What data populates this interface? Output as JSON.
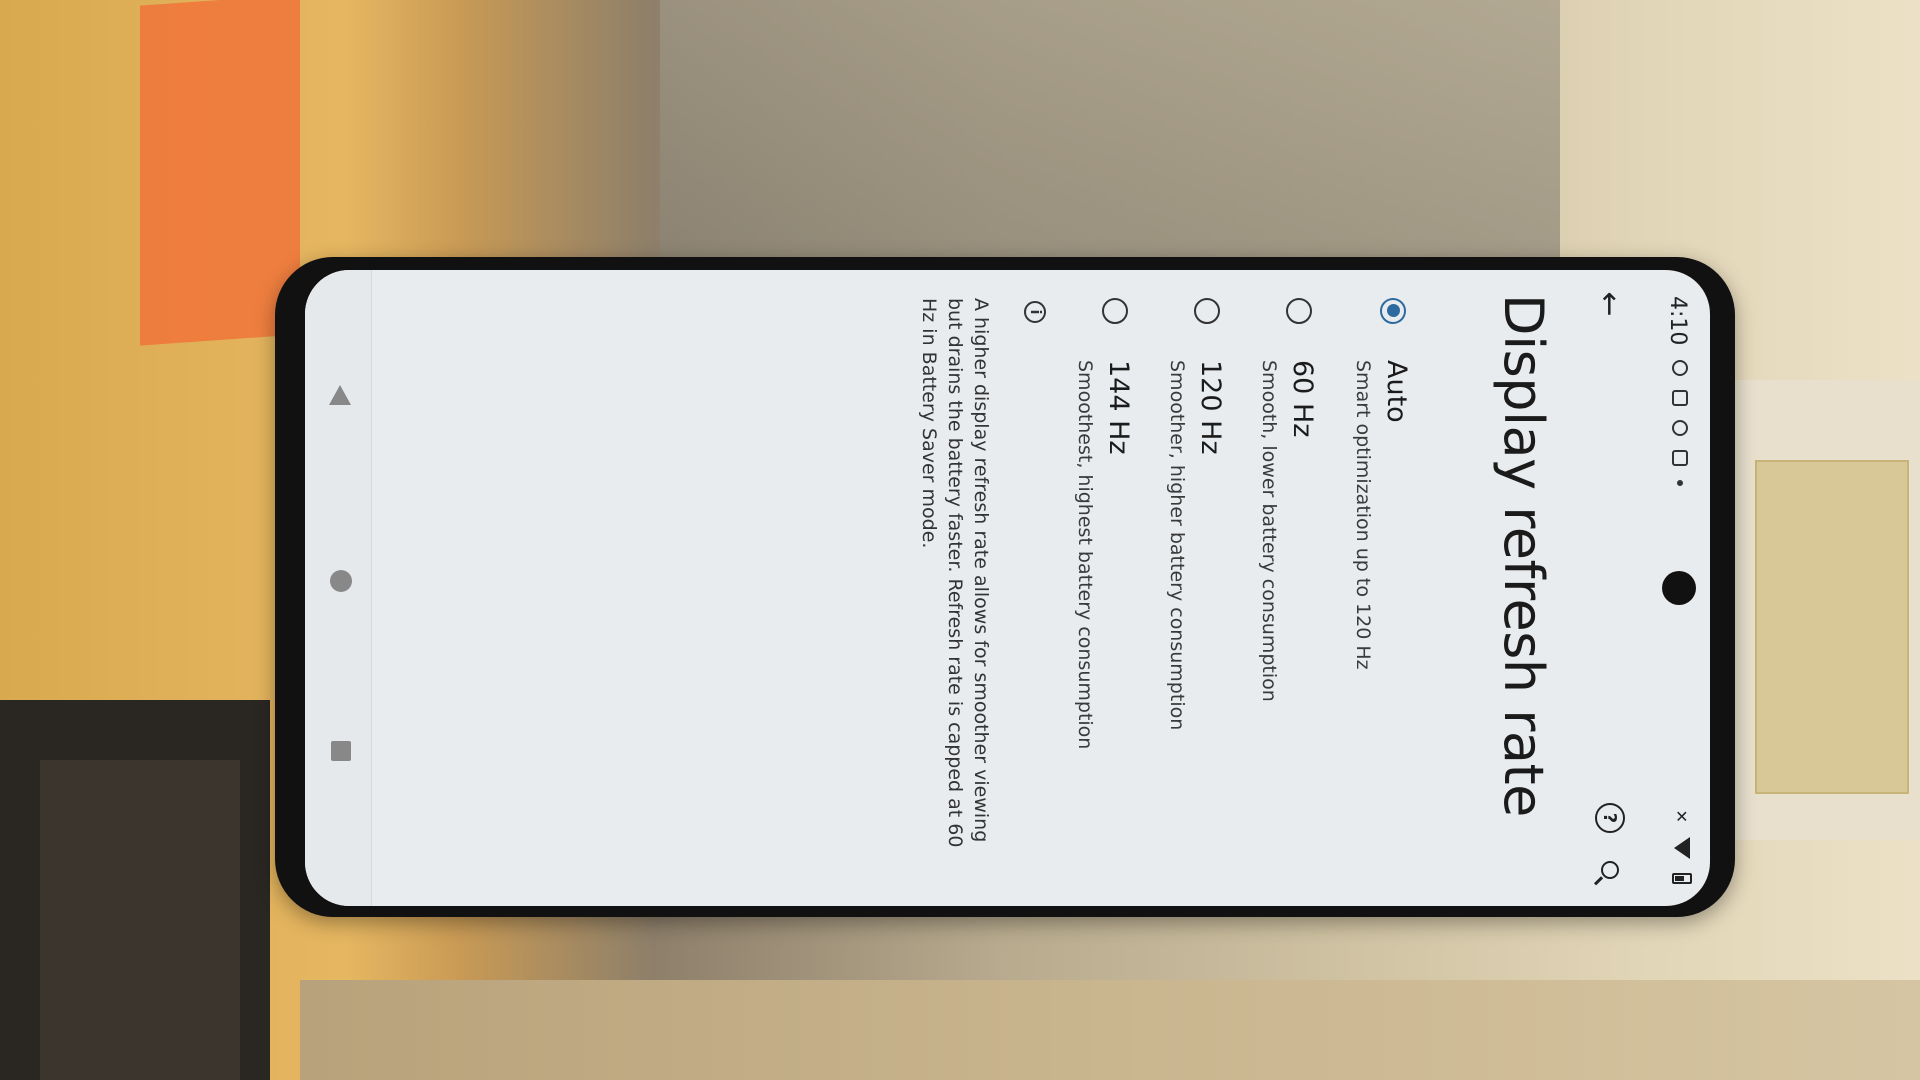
{
  "status_bar": {
    "time": "4:10",
    "icons": [
      "status-circle-icon",
      "status-image-icon",
      "status-shield-icon",
      "status-battery-saver-icon",
      "status-dot-icon"
    ],
    "right_icons": [
      "no-signal-icon",
      "wifi-icon",
      "battery-icon"
    ]
  },
  "app_bar": {
    "back_icon": "arrow-back-icon",
    "help_icon": "help-icon",
    "search_icon": "search-icon"
  },
  "page": {
    "title": "Display refresh rate"
  },
  "options": [
    {
      "label": "Auto",
      "subtitle": "Smart optimization up to 120 Hz",
      "selected": true
    },
    {
      "label": "60 Hz",
      "subtitle": "Smooth, lower battery consumption",
      "selected": false
    },
    {
      "label": "120 Hz",
      "subtitle": "Smoother, higher battery consumption",
      "selected": false
    },
    {
      "label": "144 Hz",
      "subtitle": "Smoothest, highest battery consumption",
      "selected": false
    }
  ],
  "info": {
    "icon": "info-icon",
    "text": "A higher display refresh rate allows for smoother viewing but drains the battery faster. Refresh rate is capped at 60 Hz in Battery Saver mode."
  },
  "nav_bar": {
    "back": "nav-back-icon",
    "home": "nav-home-icon",
    "recents": "nav-recents-icon"
  },
  "colors": {
    "accent": "#2c6aa0",
    "screen_bg": "#e9ecef"
  }
}
